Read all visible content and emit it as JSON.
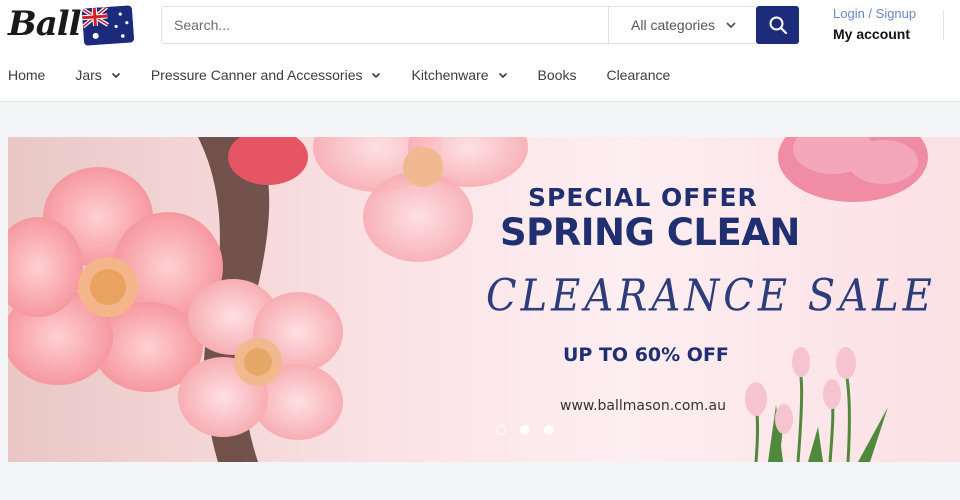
{
  "brand": {
    "logo_text": "Ball",
    "flag_icon": "australia-flag-icon"
  },
  "search": {
    "placeholder": "Search...",
    "category_label": "All categories",
    "button_icon": "search-icon"
  },
  "account": {
    "login_label": "Login / Signup",
    "my_account_label": "My account"
  },
  "nav": {
    "items": [
      {
        "label": "Home",
        "has_dropdown": false
      },
      {
        "label": "Jars",
        "has_dropdown": true
      },
      {
        "label": "Pressure Canner and Accessories",
        "has_dropdown": true
      },
      {
        "label": "Kitchenware",
        "has_dropdown": true
      },
      {
        "label": "Books",
        "has_dropdown": false
      },
      {
        "label": "Clearance",
        "has_dropdown": false
      }
    ]
  },
  "banner": {
    "line1": "SPECIAL OFFER",
    "line2": "SPRING CLEAN",
    "line3": "CLEARANCE SALE",
    "line4": "UP TO 60% OFF",
    "url": "www.ballmason.com.au",
    "slides": 3,
    "active_slide": 2
  },
  "colors": {
    "accent": "#1c2b7a",
    "link": "#6c86c6",
    "banner_text": "#1f2f6f"
  }
}
